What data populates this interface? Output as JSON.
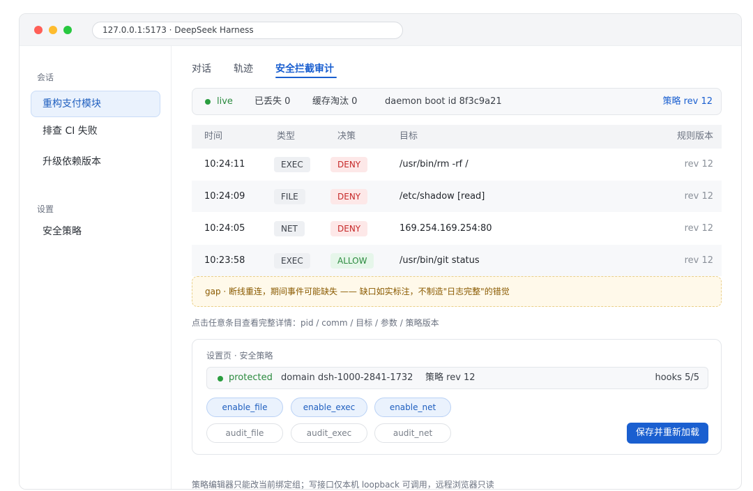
{
  "browser": {
    "url": "127.0.0.1:5173 · DeepSeek Harness"
  },
  "sidebar": {
    "group1": "会话",
    "items": [
      "重构支付模块",
      "排查 CI 失败",
      "升级依赖版本"
    ],
    "group2": "设置",
    "settings_items": [
      "安全策略"
    ]
  },
  "tabs": [
    "对话",
    "轨迹",
    "安全拦截审计"
  ],
  "status": {
    "live": "live",
    "lost": "已丢失 0",
    "evicted": "缓存淘汰 0",
    "boot": "daemon boot id 8f3c9a21",
    "policy_rev": "策略 rev 12"
  },
  "table": {
    "headers": [
      "时间",
      "类型",
      "决策",
      "目标",
      "规则版本"
    ],
    "rows": [
      {
        "time": "10:24:11",
        "type": "EXEC",
        "decision": "DENY",
        "target": "/usr/bin/rm -rf /",
        "rev": "rev 12"
      },
      {
        "time": "10:24:09",
        "type": "FILE",
        "decision": "DENY",
        "target": "/etc/shadow [read]",
        "rev": "rev 12"
      },
      {
        "time": "10:24:05",
        "type": "NET",
        "decision": "DENY",
        "target": "169.254.169.254:80",
        "rev": "rev 12"
      },
      {
        "time": "10:23:58",
        "type": "EXEC",
        "decision": "ALLOW",
        "target": "/usr/bin/git status",
        "rev": "rev 12"
      }
    ]
  },
  "gap_notice": "gap · 断线重连，期间事件可能缺失 —— 缺口如实标注，不制造\"日志完整\"的错觉",
  "hint": "点击任意条目查看完整详情：pid / comm / 目标 / 参数 / 策略版本",
  "policy": {
    "title": "设置页 · 安全策略",
    "status": "protected",
    "domain": "domain dsh-1000-2841-1732",
    "rev": "策略 rev 12",
    "hooks": "hooks 5/5",
    "enable": [
      "enable_file",
      "enable_exec",
      "enable_net"
    ],
    "audit": [
      "audit_file",
      "audit_exec",
      "audit_net"
    ],
    "save_label": "保存并重新加载"
  },
  "footer": "策略编辑器只能改当前绑定组；写接口仅本机 loopback 可调用，远程浏览器只读",
  "colors": {
    "accent": "#1a5fd0",
    "deny": "#c62828",
    "allow": "#2a8a3e",
    "live": "#2a9d3f"
  }
}
